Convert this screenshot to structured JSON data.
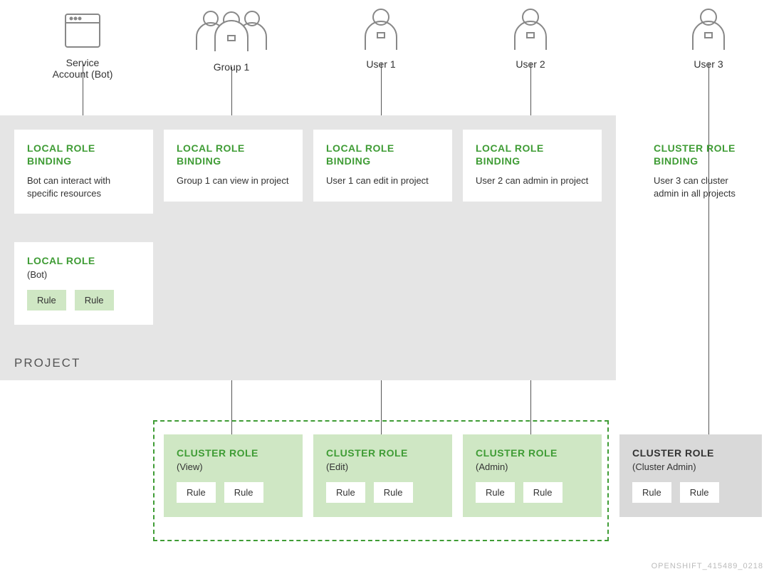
{
  "subjects": {
    "service_account": "Service Account (Bot)",
    "group1": "Group 1",
    "user1": "User 1",
    "user2": "User 2",
    "user3": "User 3"
  },
  "bindings": {
    "bot": {
      "title": "LOCAL ROLE BINDING",
      "desc": "Bot can interact with specific resources"
    },
    "group1": {
      "title": "LOCAL ROLE BINDING",
      "desc": "Group 1 can view in project"
    },
    "user1": {
      "title": "LOCAL ROLE BINDING",
      "desc": "User 1 can edit in project"
    },
    "user2": {
      "title": "LOCAL ROLE BINDING",
      "desc": "User 2 can admin in project"
    },
    "user3": {
      "title": "CLUSTER ROLE BINDING",
      "desc": "User 3 can cluster admin in all projects"
    }
  },
  "local_role": {
    "title": "LOCAL ROLE",
    "sub": "(Bot)",
    "rule1": "Rule",
    "rule2": "Rule"
  },
  "cluster_roles": {
    "view": {
      "title": "CLUSTER ROLE",
      "sub": "(View)",
      "rule1": "Rule",
      "rule2": "Rule"
    },
    "edit": {
      "title": "CLUSTER ROLE",
      "sub": "(Edit)",
      "rule1": "Rule",
      "rule2": "Rule"
    },
    "admin": {
      "title": "CLUSTER ROLE",
      "sub": "(Admin)",
      "rule1": "Rule",
      "rule2": "Rule"
    },
    "cadmin": {
      "title": "CLUSTER ROLE",
      "sub": "(Cluster Admin)",
      "rule1": "Rule",
      "rule2": "Rule"
    }
  },
  "project_label": "PROJECT",
  "footer": "OPENSHIFT_415489_0218"
}
